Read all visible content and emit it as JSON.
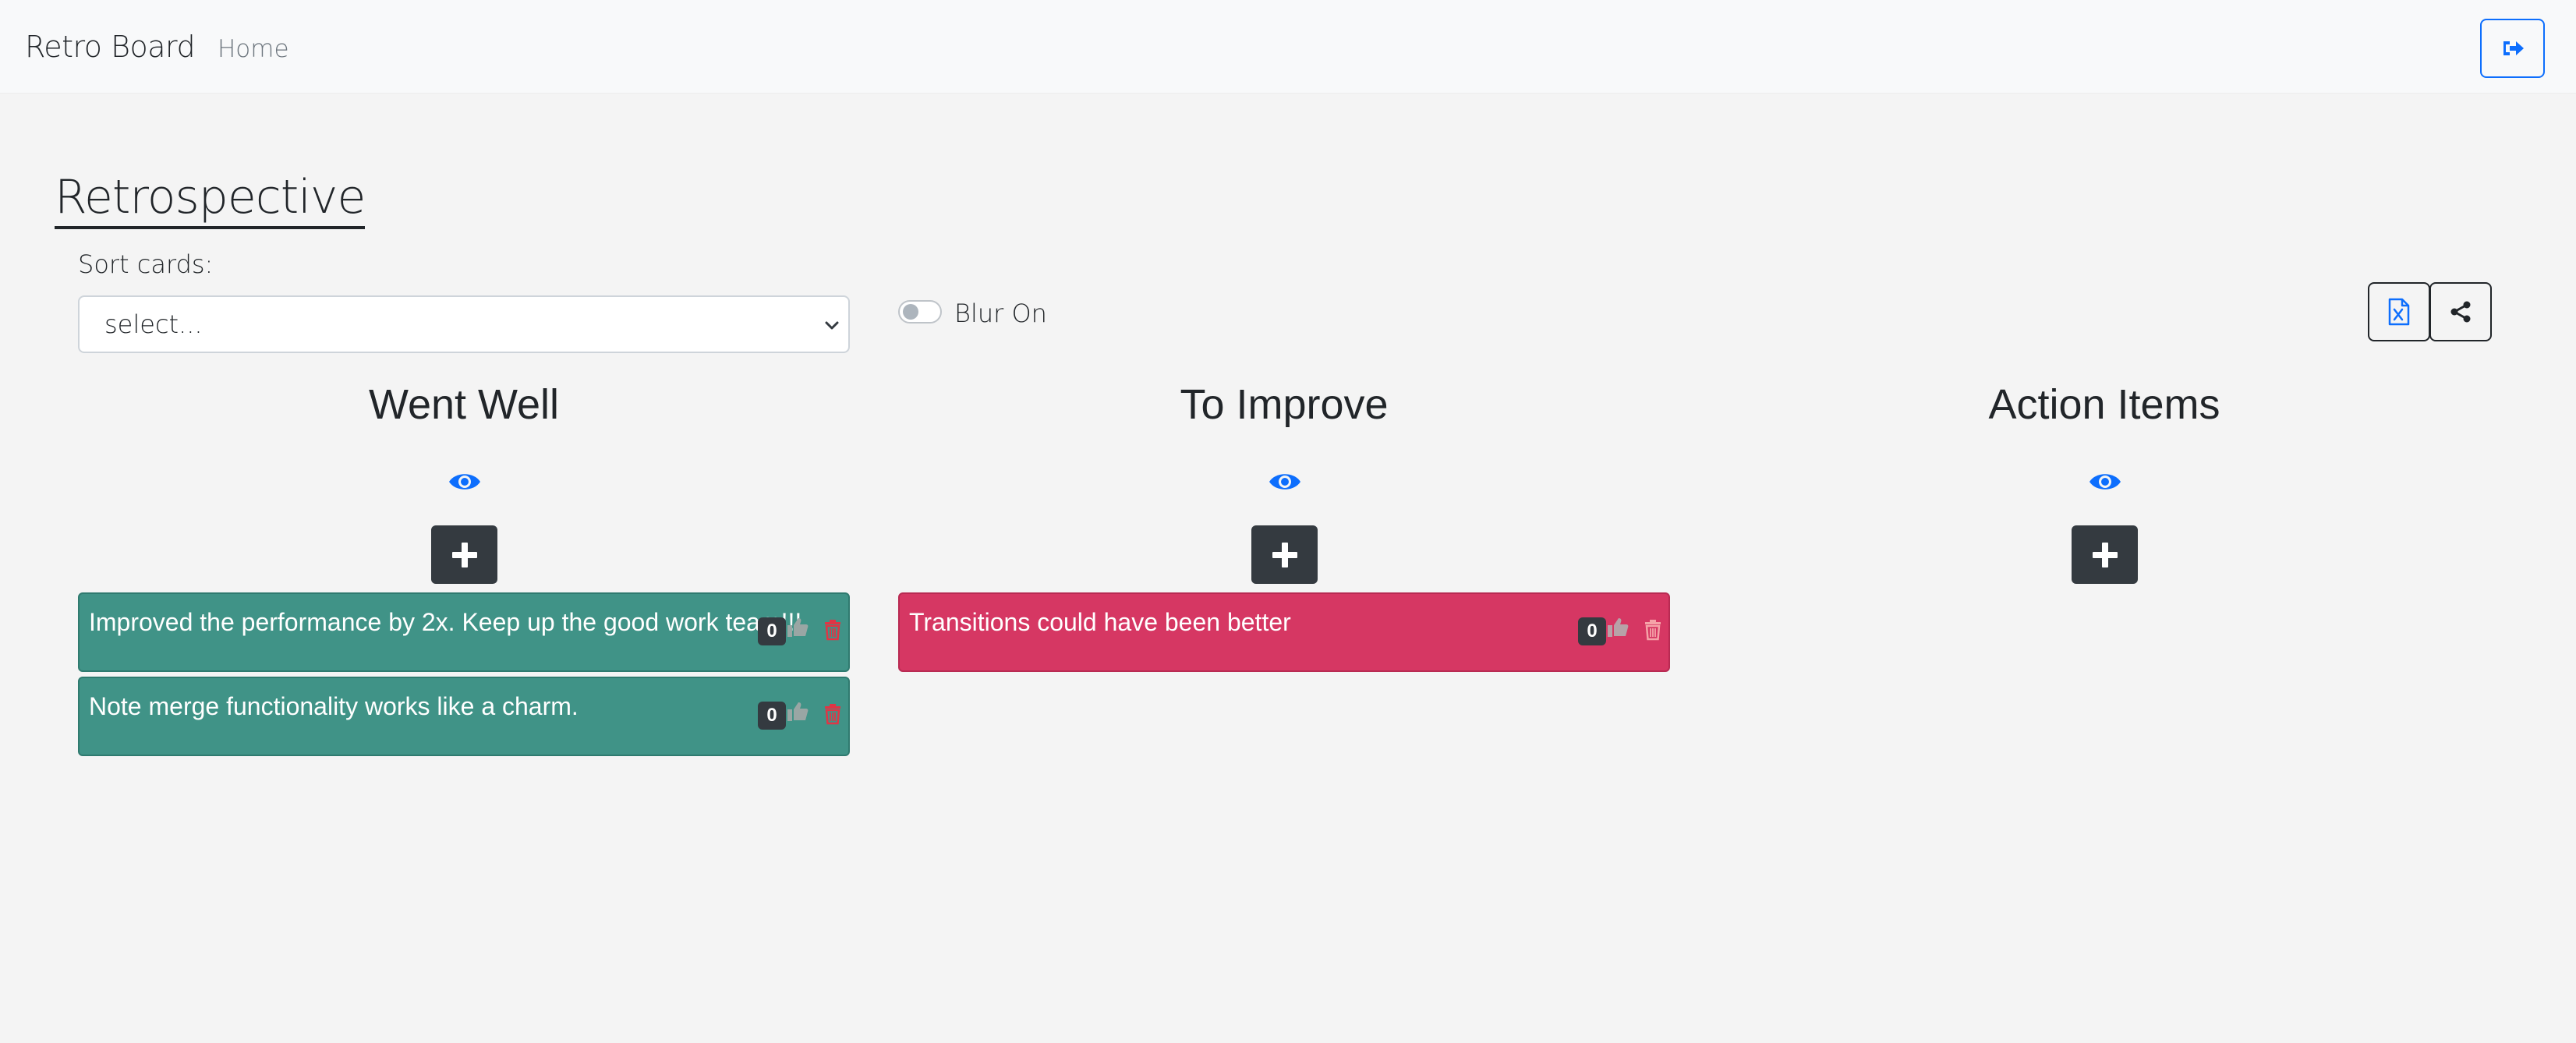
{
  "navbar": {
    "brand": "Retro Board",
    "home_link": "Home",
    "logout_icon": "sign-out-icon"
  },
  "page": {
    "title": "Retrospective",
    "sort_label": "Sort cards:",
    "sort_select_value": "select...",
    "blur_toggle_label": "Blur On",
    "blur_toggle_on": false,
    "export_icon": "excel-file-icon",
    "share_icon": "share-icon"
  },
  "colors": {
    "went_well": "#409387",
    "to_improve": "#d63763",
    "dark_button": "#343a40",
    "accent": "#0d6efd"
  },
  "columns": [
    {
      "title": "Went Well",
      "cards": [
        {
          "text": "Improved the performance by 2x. Keep up the good work team!!!",
          "votes": "0"
        },
        {
          "text": "Note merge functionality works like a charm.",
          "votes": "0"
        }
      ]
    },
    {
      "title": "To Improve",
      "cards": [
        {
          "text": "Transitions could have been better",
          "votes": "0"
        }
      ]
    },
    {
      "title": "Action Items",
      "cards": []
    }
  ]
}
